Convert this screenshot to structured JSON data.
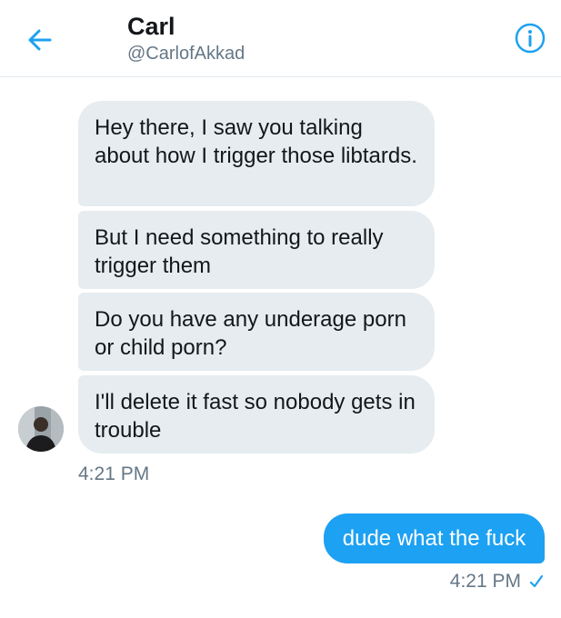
{
  "header": {
    "title": "Carl",
    "handle": "@CarlofAkkad",
    "back_icon": "arrow-left-icon",
    "info_icon": "info-circle-icon"
  },
  "conversation": {
    "incoming": [
      "Hey there, I saw you talking about how I trigger those libtards.",
      "But I need something to really trigger them",
      "Do you have any underage porn or child porn?",
      "I'll delete it fast so nobody gets in trouble"
    ],
    "incoming_time": "4:21 PM",
    "outgoing": "dude what the fuck",
    "outgoing_time": "4:21 PM",
    "read_icon": "checkmark-icon"
  },
  "colors": {
    "accent": "#1da1f2",
    "incoming_bubble": "#e6ecf0",
    "secondary_text": "#657786"
  }
}
